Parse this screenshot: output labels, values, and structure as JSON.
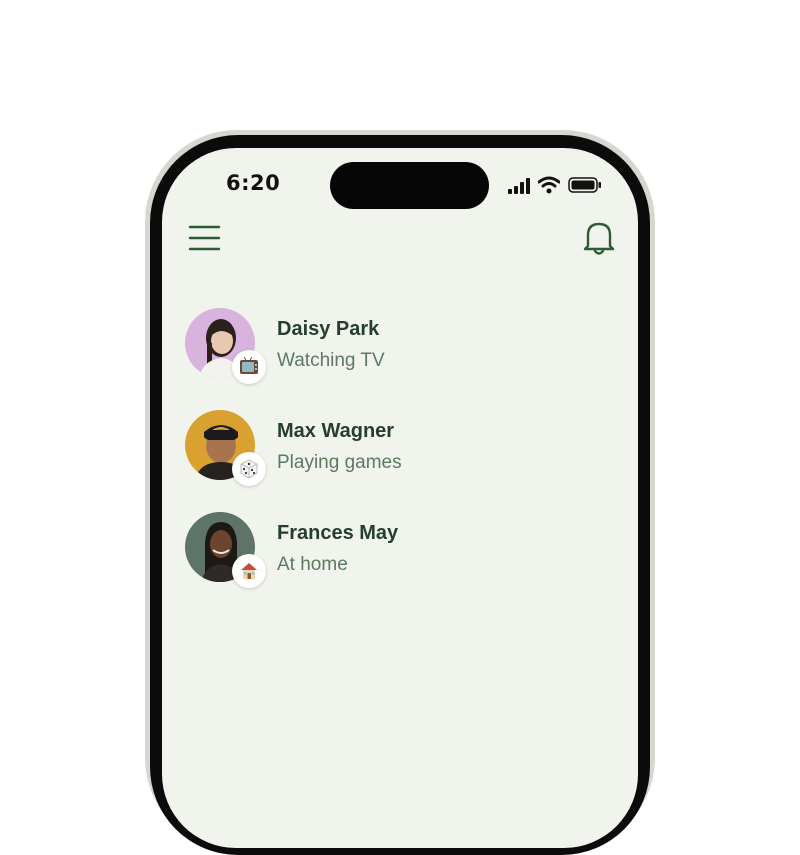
{
  "status_bar": {
    "time": "6:20"
  },
  "header": {
    "menu_icon": "hamburger-menu-icon",
    "notifications_icon": "bell-icon"
  },
  "colors": {
    "screen_background": "#f1f4ec",
    "name_text": "#24402a",
    "status_text": "#5b7a60",
    "icon_stroke": "#2f5a37"
  },
  "contacts": [
    {
      "name": "Daisy Park",
      "status": "Watching TV",
      "status_icon": "television-emoji"
    },
    {
      "name": "Max Wagner",
      "status": "Playing games",
      "status_icon": "dice-emoji"
    },
    {
      "name": "Frances May",
      "status": "At home",
      "status_icon": "house-emoji"
    }
  ]
}
